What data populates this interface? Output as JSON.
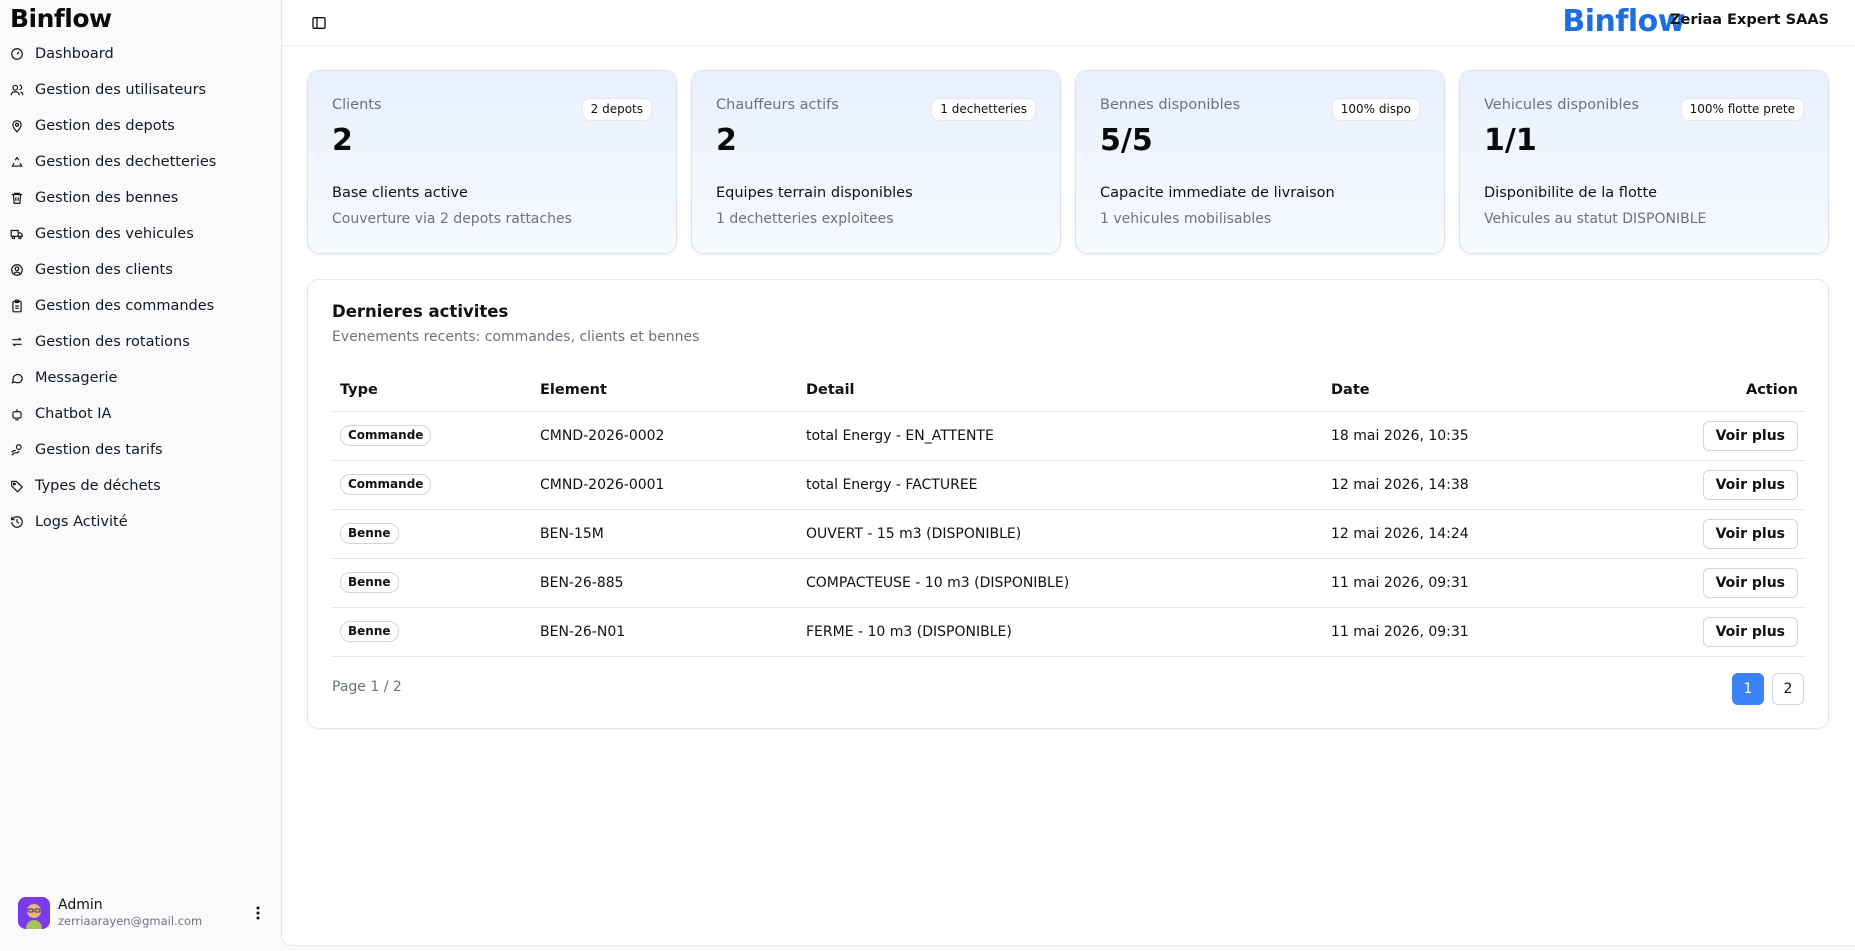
{
  "sidebar": {
    "logo": "Binflow",
    "items": [
      {
        "label": "Dashboard",
        "icon": "dashboard-icon"
      },
      {
        "label": "Gestion des utilisateurs",
        "icon": "users-icon"
      },
      {
        "label": "Gestion des depots",
        "icon": "map-pin-icon"
      },
      {
        "label": "Gestion des dechetteries",
        "icon": "recycle-icon"
      },
      {
        "label": "Gestion des bennes",
        "icon": "trash-icon"
      },
      {
        "label": "Gestion des vehicules",
        "icon": "truck-icon"
      },
      {
        "label": "Gestion des clients",
        "icon": "user-circle-icon"
      },
      {
        "label": "Gestion des commandes",
        "icon": "clipboard-icon"
      },
      {
        "label": "Gestion des rotations",
        "icon": "arrows-icon"
      },
      {
        "label": "Messagerie",
        "icon": "message-icon"
      },
      {
        "label": "Chatbot IA",
        "icon": "bot-icon"
      },
      {
        "label": "Gestion des tarifs",
        "icon": "hand-coins-icon"
      },
      {
        "label": "Types de déchets",
        "icon": "tag-icon"
      },
      {
        "label": "Logs Activité",
        "icon": "history-icon"
      }
    ],
    "user": {
      "name": "Admin",
      "email": "zerriaarayen@gmail.com"
    }
  },
  "header": {
    "brand_logo": "Binflow",
    "brand_name": "Zeriaa Expert SAAS"
  },
  "cards": [
    {
      "label": "Clients",
      "badge": "2 depots",
      "value": "2",
      "sub": "Base clients active",
      "desc": "Couverture via 2 depots rattaches"
    },
    {
      "label": "Chauffeurs actifs",
      "badge": "1 dechetteries",
      "value": "2",
      "sub": "Equipes terrain disponibles",
      "desc": "1 dechetteries exploitees"
    },
    {
      "label": "Bennes disponibles",
      "badge": "100% dispo",
      "value": "5/5",
      "sub": "Capacite immediate de livraison",
      "desc": "1 vehicules mobilisables"
    },
    {
      "label": "Vehicules disponibles",
      "badge": "100% flotte prete",
      "value": "1/1",
      "sub": "Disponibilite de la flotte",
      "desc": "Vehicules au statut DISPONIBLE"
    }
  ],
  "activity": {
    "title": "Dernieres activites",
    "subtitle": "Evenements recents: commandes, clients et bennes",
    "columns": {
      "type": "Type",
      "element": "Element",
      "detail": "Detail",
      "date": "Date",
      "action": "Action"
    },
    "rows": [
      {
        "type": "Commande",
        "element": "CMND-2026-0002",
        "detail": "total Energy - EN_ATTENTE",
        "date": "18 mai 2026, 10:35",
        "action": "Voir plus"
      },
      {
        "type": "Commande",
        "element": "CMND-2026-0001",
        "detail": "total Energy - FACTUREE",
        "date": "12 mai 2026, 14:38",
        "action": "Voir plus"
      },
      {
        "type": "Benne",
        "element": "BEN-15M",
        "detail": "OUVERT - 15 m3 (DISPONIBLE)",
        "date": "12 mai 2026, 14:24",
        "action": "Voir plus"
      },
      {
        "type": "Benne",
        "element": "BEN-26-885",
        "detail": "COMPACTEUSE - 10 m3 (DISPONIBLE)",
        "date": "11 mai 2026, 09:31",
        "action": "Voir plus"
      },
      {
        "type": "Benne",
        "element": "BEN-26-N01",
        "detail": "FERME - 10 m3 (DISPONIBLE)",
        "date": "11 mai 2026, 09:31",
        "action": "Voir plus"
      }
    ],
    "pager_label": "Page 1 / 2",
    "pages": [
      "1",
      "2"
    ]
  },
  "colors": {
    "accent": "#3b82f6",
    "brand": "#1d6fe0"
  }
}
